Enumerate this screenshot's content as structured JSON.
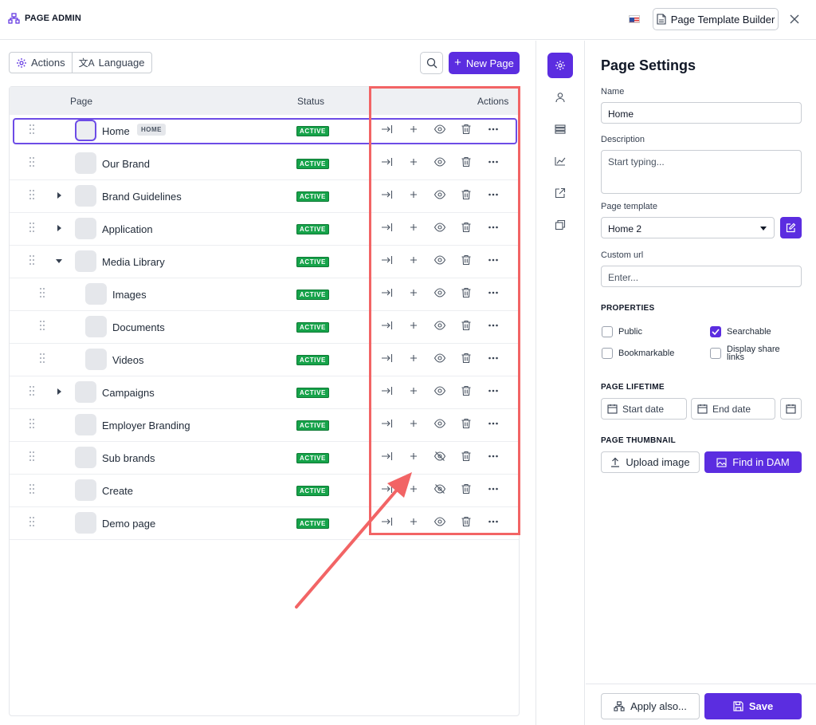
{
  "header": {
    "title": "PAGE ADMIN",
    "builder_label": "Page Template Builder"
  },
  "toolbar": {
    "actions_label": "Actions",
    "language_label": "Language",
    "new_page_label": "New Page"
  },
  "table": {
    "columns": {
      "page": "Page",
      "status": "Status",
      "actions": "Actions"
    },
    "home_badge": "HOME",
    "rows": [
      {
        "name": "Home",
        "status": "ACTIVE",
        "visible": true
      },
      {
        "name": "Our Brand",
        "status": "ACTIVE",
        "visible": true
      },
      {
        "name": "Brand Guidelines",
        "status": "ACTIVE",
        "visible": true
      },
      {
        "name": "Application",
        "status": "ACTIVE",
        "visible": true
      },
      {
        "name": "Media Library",
        "status": "ACTIVE",
        "visible": true
      },
      {
        "name": "Images",
        "status": "ACTIVE",
        "visible": true
      },
      {
        "name": "Documents",
        "status": "ACTIVE",
        "visible": true
      },
      {
        "name": "Videos",
        "status": "ACTIVE",
        "visible": true
      },
      {
        "name": "Campaigns",
        "status": "ACTIVE",
        "visible": true
      },
      {
        "name": "Employer Branding",
        "status": "ACTIVE",
        "visible": true
      },
      {
        "name": "Sub brands",
        "status": "ACTIVE",
        "visible": false
      },
      {
        "name": "Create",
        "status": "ACTIVE",
        "visible": false
      },
      {
        "name": "Demo page",
        "status": "ACTIVE",
        "visible": true
      }
    ]
  },
  "settings": {
    "title": "Page Settings",
    "name_label": "Name",
    "name_value": "Home",
    "description_label": "Description",
    "description_placeholder": "Start typing...",
    "template_label": "Page template",
    "template_value": "Home 2",
    "custom_url_label": "Custom url",
    "custom_url_placeholder": "Enter...",
    "properties_label": "PROPERTIES",
    "properties": {
      "public": {
        "label": "Public",
        "checked": false
      },
      "searchable": {
        "label": "Searchable",
        "checked": true
      },
      "bookmarkable": {
        "label": "Bookmarkable",
        "checked": false
      },
      "share": {
        "label": "Display share links",
        "checked": false
      }
    },
    "lifetime_label": "PAGE LIFETIME",
    "start_date": "Start date",
    "end_date": "End date",
    "thumbnail_label": "PAGE THUMBNAIL",
    "upload_label": "Upload image",
    "find_label": "Find in DAM",
    "apply_label": "Apply also...",
    "save_label": "Save"
  },
  "colors": {
    "accent": "#5b2de0",
    "active": "#16a34a",
    "highlight": "#f26465"
  }
}
